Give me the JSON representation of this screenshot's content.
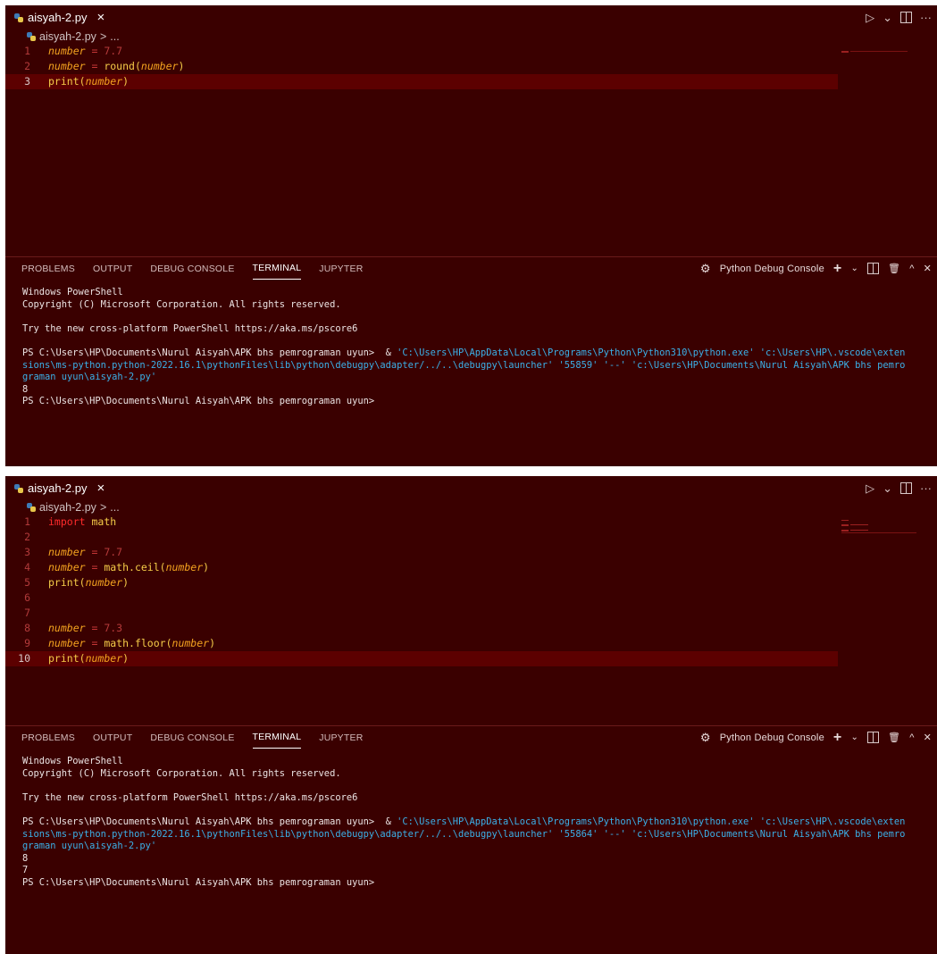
{
  "colors": {
    "panel_bg": "#3a0000",
    "current_line": "#5c0000",
    "keyword": "#ff2b2b",
    "variable": "#f3a31f",
    "function": "#f5cc48",
    "terminal_string": "#3bb0e8"
  },
  "panels": [
    {
      "tab": {
        "filename": "aisyah-2.py",
        "close": "×"
      },
      "breadcrumb": {
        "file": "aisyah-2.py",
        "separator": ">",
        "rest": "..."
      },
      "lines": [
        {
          "n": "1",
          "tokens": [
            [
              "var",
              "number"
            ],
            [
              "op",
              " = "
            ],
            [
              "num",
              "7.7"
            ]
          ]
        },
        {
          "n": "2",
          "tokens": [
            [
              "var",
              "number"
            ],
            [
              "op",
              " = "
            ],
            [
              "fn",
              "round"
            ],
            [
              "punc",
              "("
            ],
            [
              "var",
              "number"
            ],
            [
              "punc",
              ")"
            ]
          ]
        },
        {
          "n": "3",
          "current": true,
          "tokens": [
            [
              "fn",
              "print"
            ],
            [
              "punc",
              "("
            ],
            [
              "var",
              "number"
            ],
            [
              "punc",
              ")"
            ]
          ]
        }
      ],
      "terminal_tabs": [
        "PROBLEMS",
        "OUTPUT",
        "DEBUG CONSOLE",
        "TERMINAL",
        "JUPYTER"
      ],
      "active_tab": "TERMINAL",
      "debug_console_label": "Python Debug Console",
      "terminal": [
        "Windows PowerShell",
        "Copyright (C) Microsoft Corporation. All rights reserved.",
        "",
        "Try the new cross-platform PowerShell https://aka.ms/pscore6",
        "",
        [
          [
            "t",
            "PS C:\\Users\\HP\\Documents\\Nurul Aisyah\\APK bhs pemrograman uyun>  & "
          ],
          [
            "s",
            "'C:\\Users\\HP\\AppData\\Local\\Programs\\Python\\Python310\\python.exe' 'c:\\Users\\HP\\.vscode\\exten"
          ]
        ],
        [
          [
            "s",
            "sions\\ms-python.python-2022.16.1\\pythonFiles\\lib\\python\\debugpy\\adapter/../..\\debugpy\\launcher' '55859' '--' 'c:\\Users\\HP\\Documents\\Nurul Aisyah\\APK bhs pemro"
          ]
        ],
        [
          [
            "s",
            "graman uyun\\aisyah-2.py'"
          ]
        ],
        "8",
        "PS C:\\Users\\HP\\Documents\\Nurul Aisyah\\APK bhs pemrograman uyun>"
      ]
    },
    {
      "tab": {
        "filename": "aisyah-2.py",
        "close": "×"
      },
      "breadcrumb": {
        "file": "aisyah-2.py",
        "separator": ">",
        "rest": "..."
      },
      "lines": [
        {
          "n": "1",
          "tokens": [
            [
              "kw",
              "import"
            ],
            [
              "op",
              " "
            ],
            [
              "mod",
              "math"
            ]
          ]
        },
        {
          "n": "2",
          "tokens": []
        },
        {
          "n": "3",
          "tokens": [
            [
              "var",
              "number"
            ],
            [
              "op",
              " = "
            ],
            [
              "num",
              "7.7"
            ]
          ]
        },
        {
          "n": "4",
          "tokens": [
            [
              "var",
              "number"
            ],
            [
              "op",
              " = "
            ],
            [
              "fn",
              "math.ceil"
            ],
            [
              "punc",
              "("
            ],
            [
              "var",
              "number"
            ],
            [
              "punc",
              ")"
            ]
          ]
        },
        {
          "n": "5",
          "tokens": [
            [
              "fn",
              "print"
            ],
            [
              "punc",
              "("
            ],
            [
              "var",
              "number"
            ],
            [
              "punc",
              ")"
            ]
          ]
        },
        {
          "n": "6",
          "tokens": []
        },
        {
          "n": "7",
          "tokens": []
        },
        {
          "n": "8",
          "tokens": [
            [
              "var",
              "number"
            ],
            [
              "op",
              " = "
            ],
            [
              "num",
              "7.3"
            ]
          ]
        },
        {
          "n": "9",
          "tokens": [
            [
              "var",
              "number"
            ],
            [
              "op",
              " = "
            ],
            [
              "fn",
              "math.floor"
            ],
            [
              "punc",
              "("
            ],
            [
              "var",
              "number"
            ],
            [
              "punc",
              ")"
            ]
          ]
        },
        {
          "n": "10",
          "current": true,
          "tokens": [
            [
              "fn",
              "print"
            ],
            [
              "punc",
              "("
            ],
            [
              "var",
              "number"
            ],
            [
              "punc",
              ")"
            ]
          ]
        }
      ],
      "terminal_tabs": [
        "PROBLEMS",
        "OUTPUT",
        "DEBUG CONSOLE",
        "TERMINAL",
        "JUPYTER"
      ],
      "active_tab": "TERMINAL",
      "debug_console_label": "Python Debug Console",
      "terminal": [
        "Windows PowerShell",
        "Copyright (C) Microsoft Corporation. All rights reserved.",
        "",
        "Try the new cross-platform PowerShell https://aka.ms/pscore6",
        "",
        [
          [
            "t",
            "PS C:\\Users\\HP\\Documents\\Nurul Aisyah\\APK bhs pemrograman uyun>  & "
          ],
          [
            "s",
            "'C:\\Users\\HP\\AppData\\Local\\Programs\\Python\\Python310\\python.exe' 'c:\\Users\\HP\\.vscode\\exten"
          ]
        ],
        [
          [
            "s",
            "sions\\ms-python.python-2022.16.1\\pythonFiles\\lib\\python\\debugpy\\adapter/../..\\debugpy\\launcher' '55864' '--' 'c:\\Users\\HP\\Documents\\Nurul Aisyah\\APK bhs pemro"
          ]
        ],
        [
          [
            "s",
            "graman uyun\\aisyah-2.py'"
          ]
        ],
        "8",
        "7",
        "PS C:\\Users\\HP\\Documents\\Nurul Aisyah\\APK bhs pemrograman uyun>"
      ]
    }
  ]
}
